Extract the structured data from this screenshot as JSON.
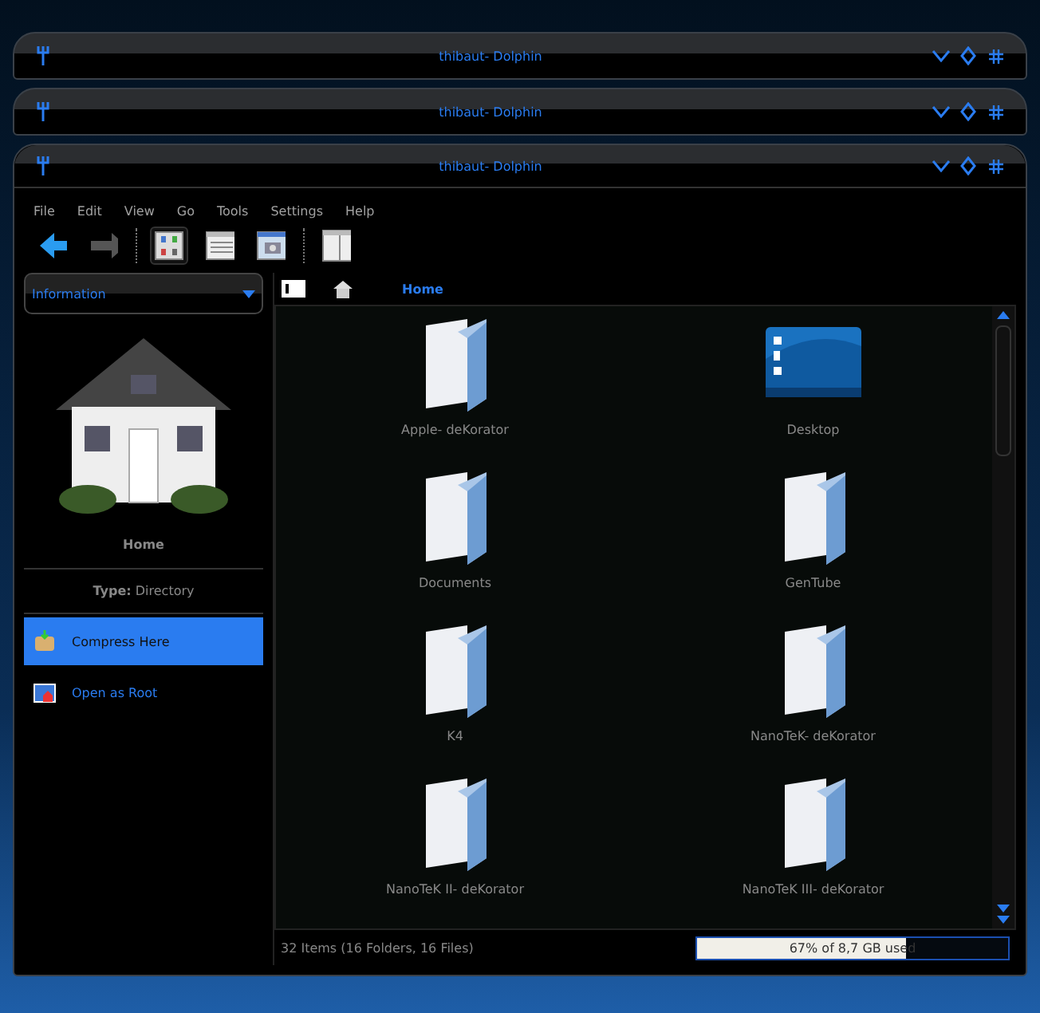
{
  "collapsed_windows": [
    {
      "title": "thibaut- Dolphin"
    },
    {
      "title": "thibaut- Dolphin"
    }
  ],
  "window": {
    "title": "thibaut- Dolphin"
  },
  "menu": [
    "File",
    "Edit",
    "View",
    "Go",
    "Tools",
    "Settings",
    "Help"
  ],
  "view_modes": [
    {
      "kind": "icons",
      "selected": true
    },
    {
      "kind": "details",
      "selected": false
    },
    {
      "kind": "preview",
      "selected": false
    }
  ],
  "sidebar": {
    "panel": "Information",
    "item_name": "Home",
    "type_label": "Type:",
    "type_value": "Directory",
    "actions": [
      {
        "label": "Compress Here",
        "kind": "compress",
        "selected": true
      },
      {
        "label": "Open as Root",
        "kind": "root",
        "selected": false
      }
    ]
  },
  "breadcrumb": "Home",
  "files": [
    {
      "name": "Apple- deKorator",
      "kind": "folder"
    },
    {
      "name": "Desktop",
      "kind": "desktop"
    },
    {
      "name": "Documents",
      "kind": "folder"
    },
    {
      "name": "GenTube",
      "kind": "folder"
    },
    {
      "name": "K4",
      "kind": "folder"
    },
    {
      "name": "NanoTeK- deKorator",
      "kind": "folder"
    },
    {
      "name": "NanoTeK II- deKorator",
      "kind": "folder"
    },
    {
      "name": "NanoTeK III- deKorator",
      "kind": "folder"
    }
  ],
  "status_bar": {
    "summary": "32 Items (16 Folders, 16 Files)",
    "disk": "67% of 8,7 GB used",
    "level": 0.67
  }
}
